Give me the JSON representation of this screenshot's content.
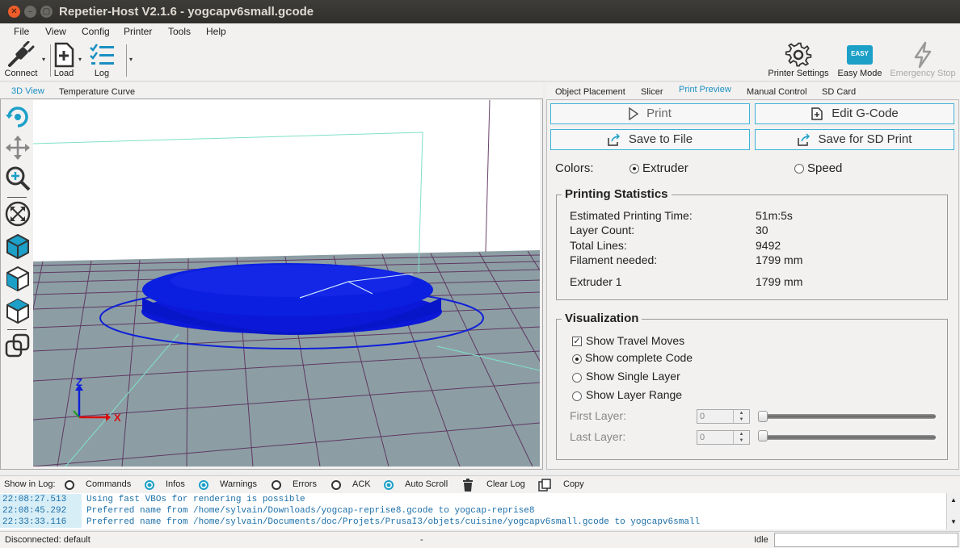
{
  "window": {
    "title": "Repetier-Host V2.1.6 - yogcapv6small.gcode",
    "close_glyph": "✕",
    "min_glyph": "–",
    "max_glyph": "▢"
  },
  "menu": [
    "File",
    "View",
    "Config",
    "Printer",
    "Tools",
    "Help"
  ],
  "toolbar": {
    "connect": "Connect",
    "load": "Load",
    "log": "Log",
    "printer_settings": "Printer Settings",
    "easy_mode": "Easy Mode",
    "easy_badge": "EASY",
    "emergency_stop": "Emergency Stop",
    "dropdown_glyph": "▾"
  },
  "left_tabs": {
    "view3d": "3D View",
    "temperature": "Temperature Curve"
  },
  "right_tabs": {
    "object_placement": "Object Placement",
    "slicer": "Slicer",
    "print_preview": "Print Preview",
    "manual_control": "Manual Control",
    "sd_card": "SD Card"
  },
  "preview": {
    "print": "Print",
    "edit_gcode": "Edit G-Code",
    "save_to_file": "Save to File",
    "save_sd": "Save for SD Print",
    "colors_label": "Colors:",
    "color_extruder": "Extruder",
    "color_speed": "Speed",
    "stats_title": "Printing Statistics",
    "stats": [
      {
        "label": "Estimated Printing Time:",
        "value": "51m:5s"
      },
      {
        "label": "Layer Count:",
        "value": "30"
      },
      {
        "label": "Total Lines:",
        "value": "9492"
      },
      {
        "label": "Filament needed:",
        "value": "1799 mm"
      },
      {
        "label": "Extruder 1",
        "value": "1799 mm"
      }
    ],
    "vis_title": "Visualization",
    "show_travel": "Show Travel Moves",
    "show_complete": "Show complete Code",
    "show_single": "Show Single Layer",
    "show_range": "Show Layer Range",
    "first_layer_label": "First Layer:",
    "last_layer_label": "Last Layer:",
    "first_layer_value": "0",
    "last_layer_value": "0",
    "check_glyph": "✓"
  },
  "axes": {
    "z": "Z",
    "x": "X"
  },
  "log": {
    "show_in_log": "Show in Log:",
    "commands": "Commands",
    "infos": "Infos",
    "warnings": "Warnings",
    "errors": "Errors",
    "ack": "ACK",
    "auto_scroll": "Auto Scroll",
    "clear_log": "Clear Log",
    "copy": "Copy",
    "rows": [
      {
        "time": "22:08:27.513",
        "msg": "Using fast VBOs for rendering is possible"
      },
      {
        "time": "22:08:45.292",
        "msg": "Preferred name from /home/sylvain/Downloads/yogcap-reprise8.gcode to yogcap-reprise8"
      },
      {
        "time": "22:33:33.116",
        "msg": "Preferred name from /home/sylvain/Documents/doc/Projets/PrusaI3/objets/cuisine/yogcapv6small.gcode to yogcapv6small"
      }
    ],
    "scroll_up": "▲",
    "scroll_down": "▼"
  },
  "status": {
    "connection": "Disconnected: default",
    "middle": "-",
    "state": "Idle"
  },
  "colors": {
    "accent": "#1a8fc2",
    "model": "#0a1fe0",
    "floor": "#8c9ea4"
  }
}
